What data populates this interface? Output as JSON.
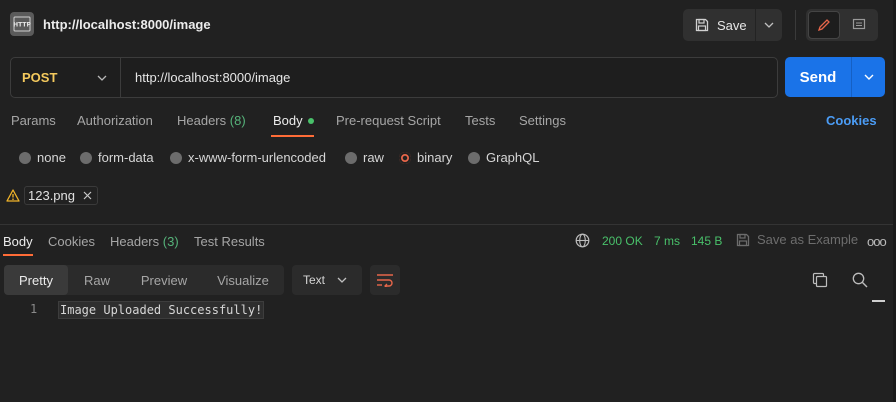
{
  "header": {
    "title": "http://localhost:8000/image",
    "save_label": "Save",
    "http_icon": "http-file-icon"
  },
  "request": {
    "method": "POST",
    "url": "http://localhost:8000/image",
    "send_label": "Send"
  },
  "request_tabs": {
    "params": "Params",
    "authorization": "Authorization",
    "headers": "Headers",
    "headers_count": "(8)",
    "body": "Body",
    "pre_request": "Pre-request Script",
    "tests": "Tests",
    "settings": "Settings",
    "cookies": "Cookies",
    "active": "Body"
  },
  "body_types": {
    "none": "none",
    "form_data": "form-data",
    "urlencoded": "x-www-form-urlencoded",
    "raw": "raw",
    "binary": "binary",
    "graphql": "GraphQL",
    "selected": "binary"
  },
  "file": {
    "name": "123.png"
  },
  "response_tabs": {
    "body": "Body",
    "cookies": "Cookies",
    "headers": "Headers",
    "headers_count": "(3)",
    "test_results": "Test Results",
    "active": "Body"
  },
  "response_status": {
    "status": "200 OK",
    "time": "7 ms",
    "size": "145 B",
    "save_example": "Save as Example",
    "more": "ooo"
  },
  "response_view": {
    "pretty": "Pretty",
    "raw": "Raw",
    "preview": "Preview",
    "visualize": "Visualize",
    "format": "Text",
    "active": "Pretty"
  },
  "response_body": {
    "line_number": "1",
    "content": "Image Uploaded Successfully!"
  },
  "colors": {
    "accent": "#ff6c37",
    "send": "#1a73e8",
    "success": "#49c06a",
    "method": "#f4c95d",
    "link": "#4b9cf5",
    "warning": "#f0b429"
  }
}
